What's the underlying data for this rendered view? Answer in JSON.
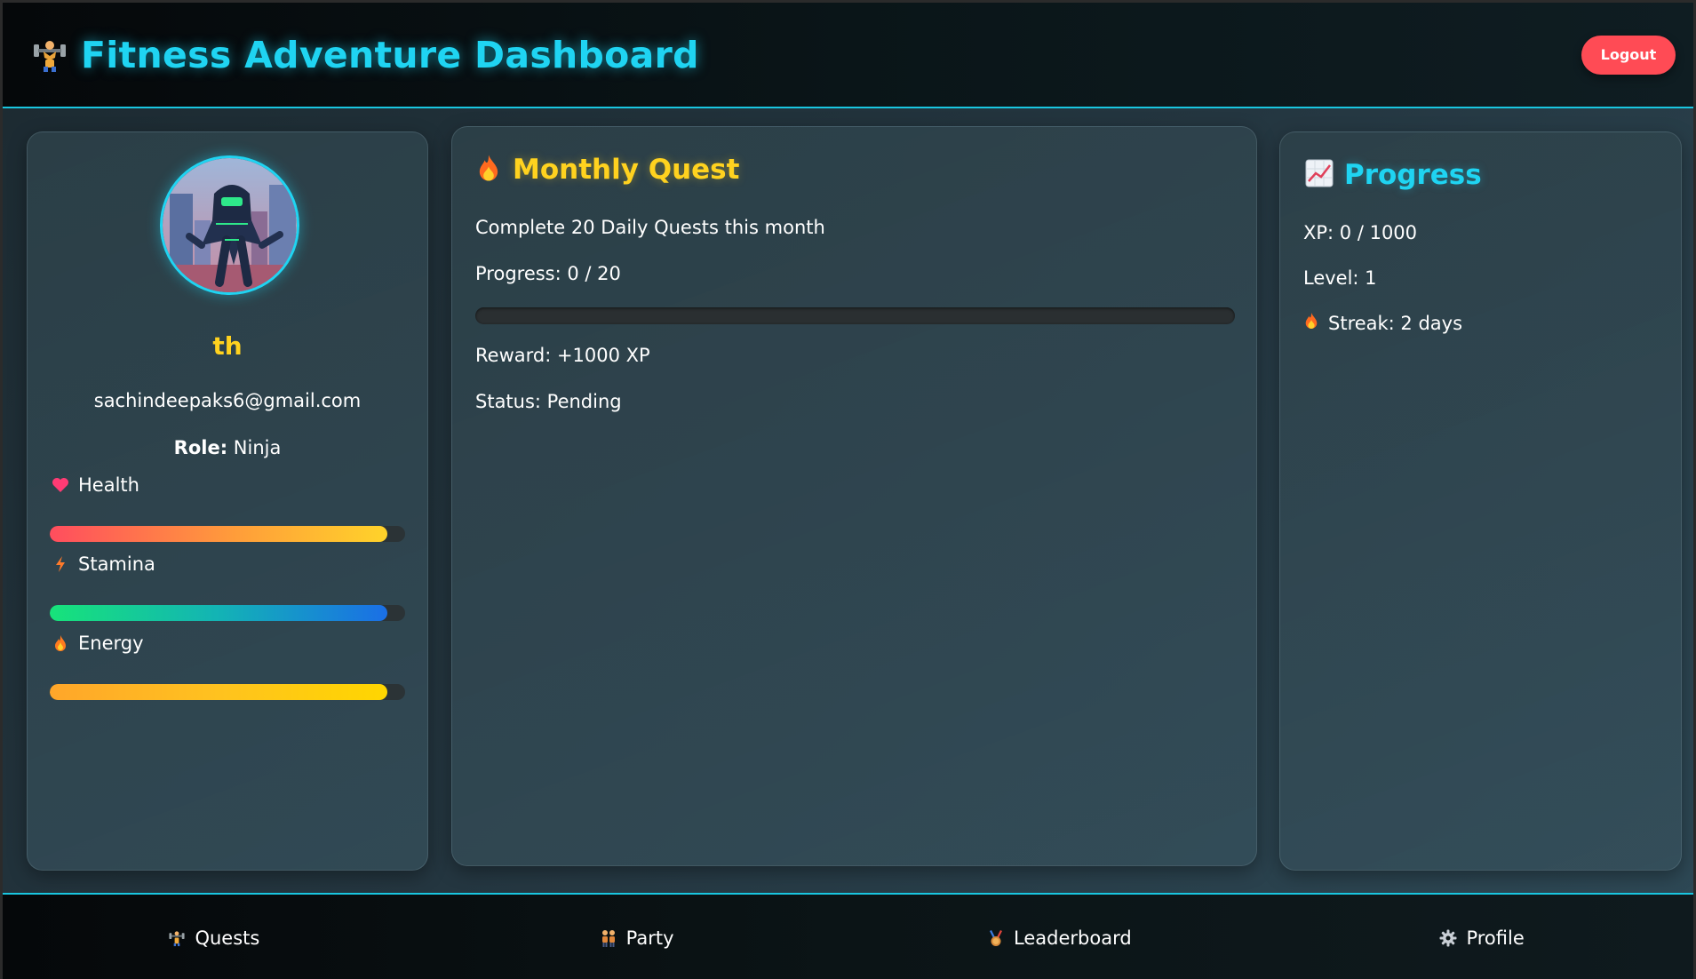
{
  "header": {
    "title": "Fitness Adventure Dashboard",
    "logout_label": "Logout"
  },
  "profile": {
    "username": "th",
    "email": "sachindeepaks6@gmail.com",
    "role_label": "Role:",
    "role_value": "Ninja",
    "stats": [
      {
        "label": "Health",
        "icon": "heart-icon",
        "fill_percent": 95
      },
      {
        "label": "Stamina",
        "icon": "lightning-icon",
        "fill_percent": 95
      },
      {
        "label": "Energy",
        "icon": "fire-icon",
        "fill_percent": 95
      }
    ]
  },
  "quest": {
    "title": "Monthly Quest",
    "description": "Complete 20 Daily Quests this month",
    "progress_text": "Progress: 0 / 20",
    "progress_fraction": 0,
    "reward_text": "Reward: +1000 XP",
    "status_text": "Status: Pending"
  },
  "progress": {
    "title": "Progress",
    "xp_text": "XP: 0 / 1000",
    "level_text": "Level: 1",
    "streak_text": "Streak: 2 days"
  },
  "nav": {
    "items": [
      {
        "label": "Quests",
        "icon": "weightlifter-icon"
      },
      {
        "label": "Party",
        "icon": "people-icon"
      },
      {
        "label": "Leaderboard",
        "icon": "medal-icon"
      },
      {
        "label": "Profile",
        "icon": "gear-icon"
      }
    ]
  },
  "colors": {
    "accent_cyan": "#1fd4f2",
    "accent_yellow": "#ffd21f",
    "logout_red": "#ff4b55"
  }
}
